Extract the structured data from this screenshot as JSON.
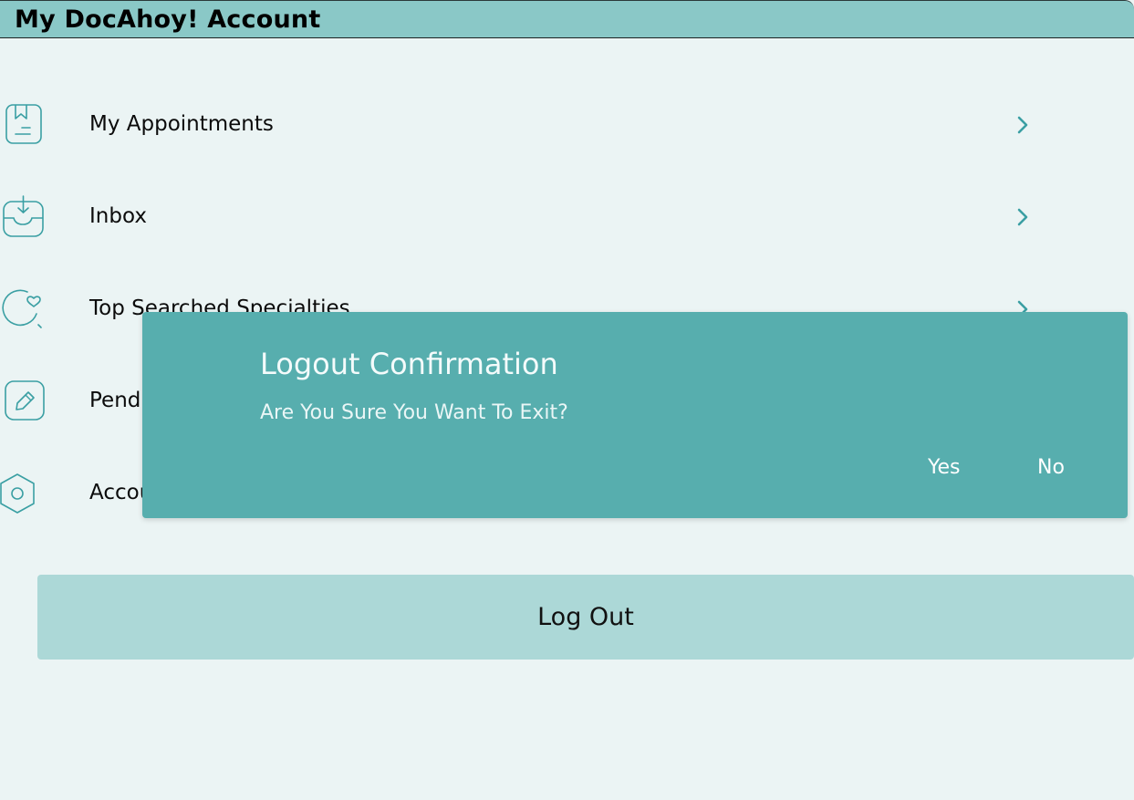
{
  "header": {
    "title": "My DocAhoy! Account"
  },
  "menu": {
    "items": [
      {
        "label": "My Appointments",
        "icon": "bookmark-list-icon"
      },
      {
        "label": " Inbox",
        "icon": "inbox-download-icon"
      },
      {
        "label": "Top Searched Specialties",
        "icon": "heart-search-icon"
      },
      {
        "label": "Pending Feedbacks",
        "icon": "edit-pencil-icon"
      },
      {
        "label": "Account Settings",
        "icon": "hexagon-settings-icon"
      }
    ]
  },
  "logout_button": {
    "label": "Log Out"
  },
  "dialog": {
    "title": "Logout Confirmation",
    "message": "Are You Sure You Want To Exit?",
    "yes_label": "Yes",
    "no_label": "No"
  },
  "colors": {
    "header_bg": "#8ac8c7",
    "page_bg": "#ebf4f4",
    "accent": "#3a9fa3",
    "dialog_bg": "#57aeae",
    "logout_bg": "#acd8d7"
  }
}
